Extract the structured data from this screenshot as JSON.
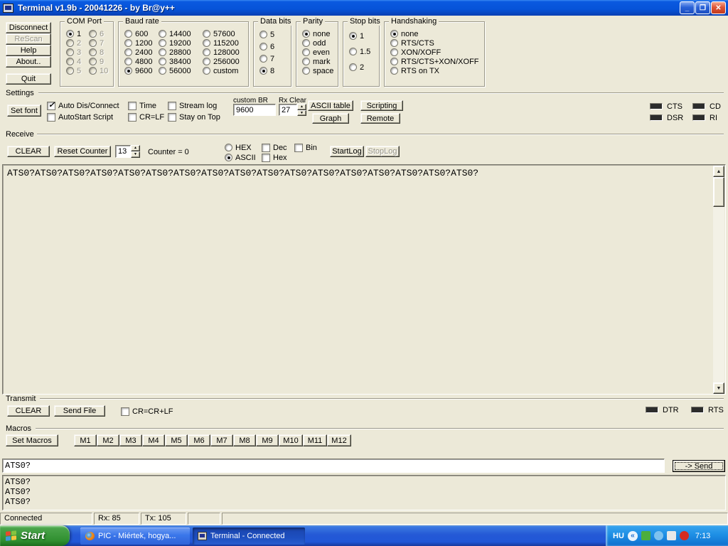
{
  "window": {
    "title": "Terminal v1.9b - 20041226 - by Br@y++"
  },
  "glyphs": {
    "minimize": "_",
    "restore": "❐",
    "close": "✕",
    "up": "▲",
    "down": "▼",
    "chevron_left": "«"
  },
  "left_buttons": {
    "disconnect": "Disconnect",
    "rescan": "ReScan",
    "help": "Help",
    "about": "About..",
    "quit": "Quit"
  },
  "com_port": {
    "label": "COM Port",
    "selected": "1",
    "options": [
      "1",
      "2",
      "3",
      "4",
      "5",
      "6",
      "7",
      "8",
      "9",
      "10"
    ]
  },
  "baud": {
    "label": "Baud rate",
    "selected": "9600",
    "options": [
      "600",
      "1200",
      "2400",
      "4800",
      "9600",
      "14400",
      "19200",
      "28800",
      "38400",
      "56000",
      "57600",
      "115200",
      "128000",
      "256000",
      "custom"
    ]
  },
  "data_bits": {
    "label": "Data bits",
    "selected": "8",
    "options": [
      "5",
      "6",
      "7",
      "8"
    ]
  },
  "parity": {
    "label": "Parity",
    "selected": "none",
    "options": [
      "none",
      "odd",
      "even",
      "mark",
      "space"
    ]
  },
  "stop_bits": {
    "label": "Stop bits",
    "selected": "1",
    "options": [
      "1",
      "1.5",
      "2"
    ]
  },
  "handshaking": {
    "label": "Handshaking",
    "selected": "none",
    "options": [
      "none",
      "RTS/CTS",
      "XON/XOFF",
      "RTS/CTS+XON/XOFF",
      "RTS on TX"
    ]
  },
  "settings": {
    "label": "Settings",
    "set_font": "Set font",
    "checks": [
      "Auto Dis/Connect",
      "AutoStart Script",
      "Time",
      "CR=LF",
      "Stream log",
      "Stay on Top"
    ],
    "checked": [
      "Auto Dis/Connect"
    ],
    "custom_br": {
      "label": "custom BR",
      "value": "9600"
    },
    "rx_clear": {
      "label": "Rx Clear",
      "value": "27"
    },
    "ascii_table": "ASCII table",
    "scripting": "Scripting",
    "graph": "Graph",
    "remote": "Remote",
    "leds": [
      "CTS",
      "DSR",
      "CD",
      "RI"
    ]
  },
  "receive": {
    "label": "Receive",
    "clear": "CLEAR",
    "reset_counter": "Reset Counter",
    "count_value": "13",
    "counter_text": "Counter = 0",
    "hex": "HEX",
    "ascii": "ASCII",
    "mode": "ASCII",
    "dec": "Dec",
    "hex_chk": "Hex",
    "bin": "Bin",
    "startlog": "StartLog",
    "stoplog": "StopLog",
    "content": "ATS0?ATS0?ATS0?ATS0?ATS0?ATS0?ATS0?ATS0?ATS0?ATS0?ATS0?ATS0?ATS0?ATS0?ATS0?ATS0?ATS0?"
  },
  "transmit": {
    "label": "Transmit",
    "clear": "CLEAR",
    "send_file": "Send File",
    "cr_crlf": "CR=CR+LF",
    "leds": [
      "DTR",
      "RTS"
    ]
  },
  "macros": {
    "label": "Macros",
    "set_macros": "Set Macros",
    "items": [
      "M1",
      "M2",
      "M3",
      "M4",
      "M5",
      "M6",
      "M7",
      "M8",
      "M9",
      "M10",
      "M11",
      "M12"
    ]
  },
  "send": {
    "value": "ATS0?",
    "button": "-> Send"
  },
  "history": [
    "ATS0?",
    "ATS0?",
    "ATS0?"
  ],
  "status": {
    "connection": "Connected",
    "rx": "Rx: 85",
    "tx": "Tx: 105"
  },
  "taskbar": {
    "start": "Start",
    "tasks": [
      {
        "title": "PIC - Miértek, hogya..."
      },
      {
        "title": "Terminal - Connected"
      }
    ],
    "lang": "HU",
    "time": "7:13"
  }
}
